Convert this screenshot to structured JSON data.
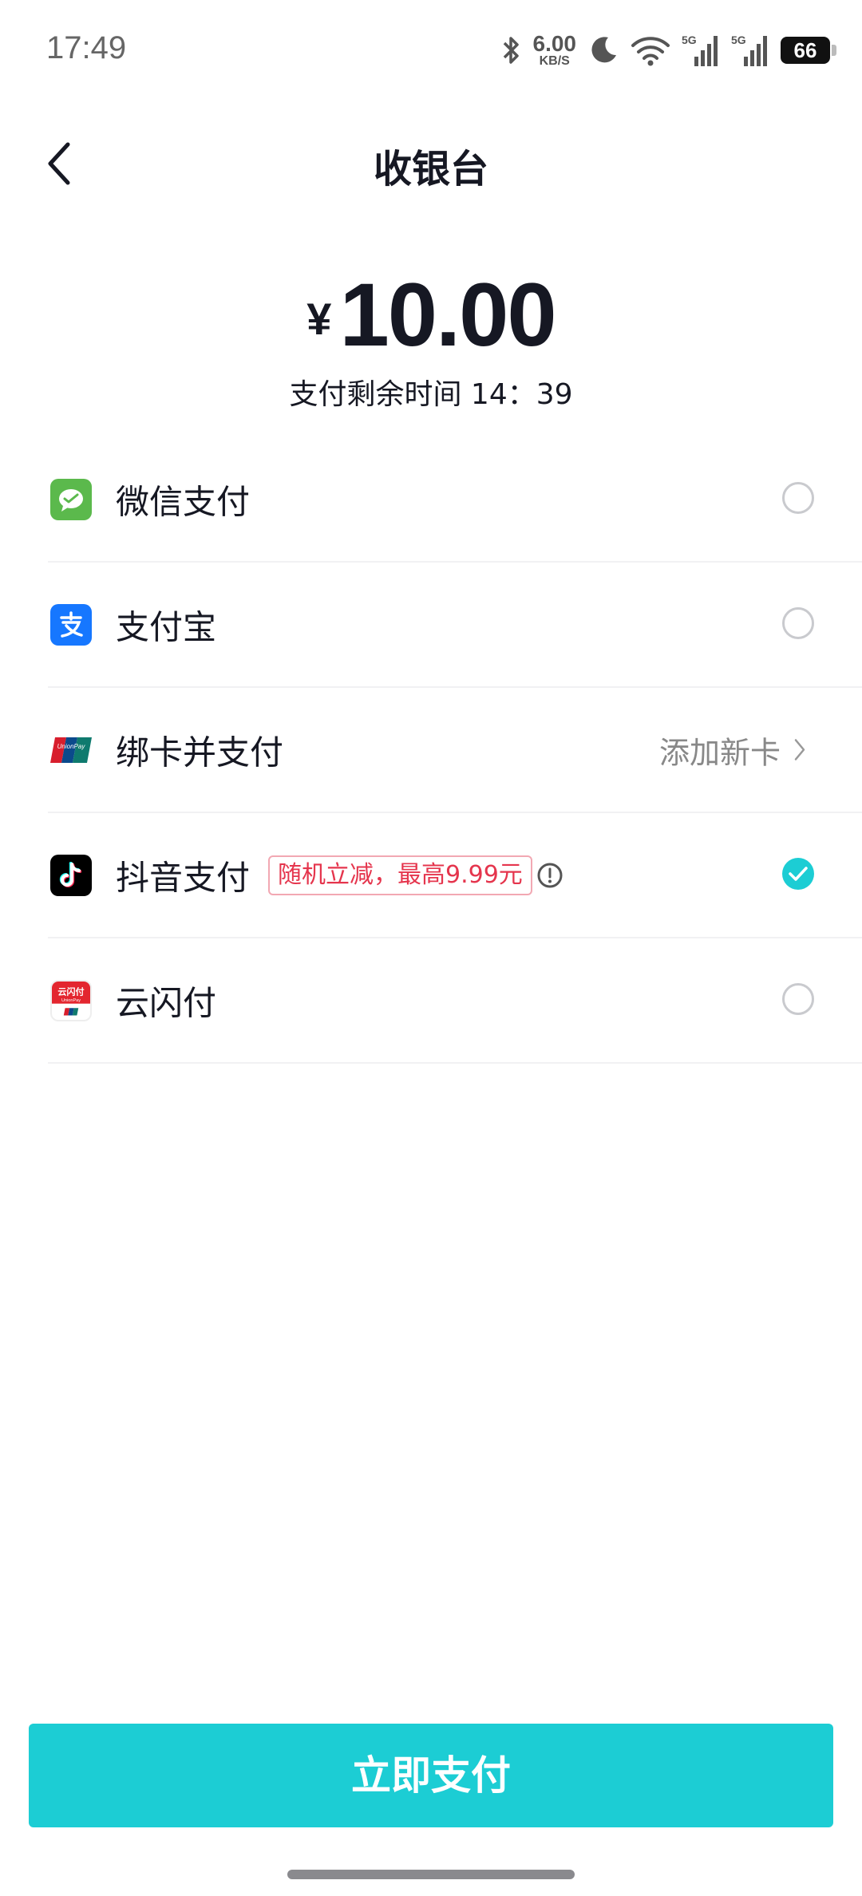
{
  "status": {
    "time": "17:49",
    "net_speed": "6.00",
    "net_unit": "KB/S",
    "battery": "66"
  },
  "header": {
    "title": "收银台"
  },
  "amount": {
    "currency": "¥",
    "value": "10.00",
    "countdown": "支付剩余时间 14：39"
  },
  "methods": [
    {
      "label": "微信支付",
      "icon": "wechat-pay-icon",
      "selected": false
    },
    {
      "label": "支付宝",
      "icon": "alipay-icon",
      "selected": false
    },
    {
      "label": "绑卡并支付",
      "icon": "unionpay-icon",
      "action": "添加新卡"
    },
    {
      "label": "抖音支付",
      "icon": "douyin-pay-icon",
      "promo": "随机立减，最高9.99元",
      "selected": true
    },
    {
      "label": "云闪付",
      "icon": "quickpass-icon",
      "selected": false
    }
  ],
  "pay_button": {
    "label": "立即支付"
  },
  "colors": {
    "accent": "#1ccdd4",
    "promo": "#e5354d",
    "wechat": "#5bb94c",
    "alipay": "#1677ff"
  }
}
